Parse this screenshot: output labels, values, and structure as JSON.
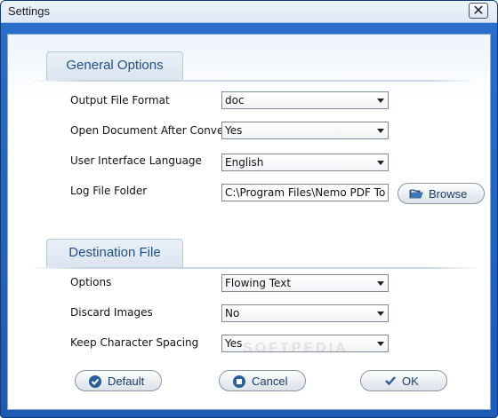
{
  "window": {
    "title": "Settings",
    "close_symbol": "✕"
  },
  "tabs": {
    "general": "General Options",
    "destination": "Destination File"
  },
  "general": {
    "output_format": {
      "label": "Output File Format",
      "value": "doc"
    },
    "open_after": {
      "label": "Open Document After Conversion",
      "value": "Yes"
    },
    "ui_language": {
      "label": "User Interface Language",
      "value": "English"
    },
    "log_folder": {
      "label": "Log File Folder",
      "value": "C:\\Program Files\\Nemo PDF To Word\\"
    },
    "browse_label": "Browse"
  },
  "destination": {
    "options": {
      "label": "Options",
      "value": "Flowing Text"
    },
    "discard_images": {
      "label": "Discard Images",
      "value": "No"
    },
    "keep_spacing": {
      "label": "Keep Character Spacing",
      "value": "Yes"
    }
  },
  "buttons": {
    "default": "Default",
    "cancel": "Cancel",
    "ok": "OK"
  },
  "watermark": "SOFTPEDIA",
  "colors": {
    "accent_blue": "#1d5bb5",
    "tab_text": "#1f4f86",
    "button_text": "#1a3c66"
  },
  "icons": [
    "close-icon",
    "folder-open-icon",
    "check-circle-icon",
    "stop-circle-icon",
    "checkmark-icon"
  ]
}
